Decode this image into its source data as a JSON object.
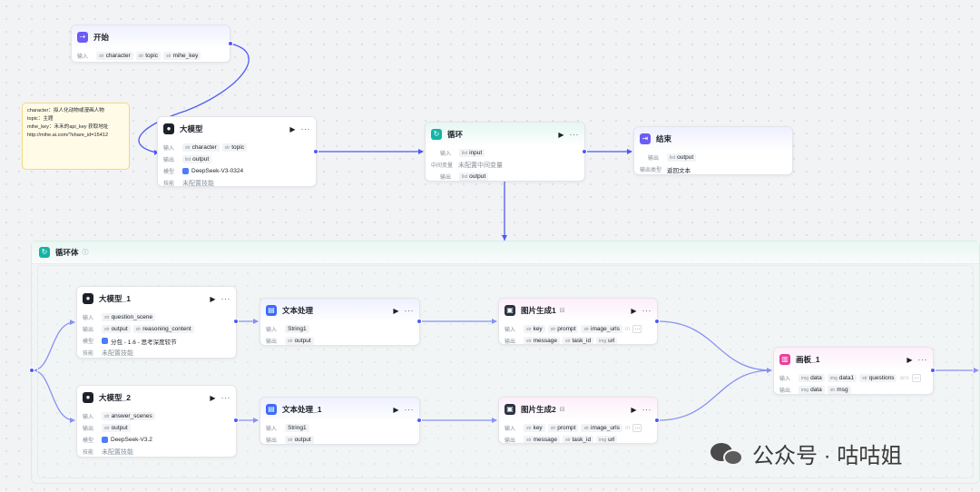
{
  "common": {
    "input_label": "输入",
    "output_label": "输出",
    "model_label": "模型",
    "skill_label": "技能",
    "skill_value": "未配置技能",
    "type_str": "str",
    "type_list": "list",
    "type_img": "img",
    "more": "···"
  },
  "note": {
    "lines": [
      "character：拟人化动物或漫画人物",
      "topic：主题",
      "mihe_key：禾禾的api_key 获取地址",
      "http://mihe.ai.com/?share_id=15412"
    ]
  },
  "start": {
    "title": "开始",
    "inputs": [
      "character",
      "topic",
      "mihe_key"
    ]
  },
  "llm_main": {
    "title": "大模型",
    "inputs": [
      "character",
      "topic"
    ],
    "outputs": [
      "output"
    ],
    "model": "DeepSeek-V3-0324"
  },
  "loop_node": {
    "title": "循环",
    "inputs": [
      "input"
    ],
    "mid_label": "中间变量",
    "mid_value": "未配置中间变量",
    "outputs": [
      "output"
    ]
  },
  "end": {
    "title": "结束",
    "outputs": [
      "output"
    ],
    "mode_label": "输出类型",
    "mode_value": "返回文本"
  },
  "loop_body": {
    "title": "循环体"
  },
  "llm1": {
    "title": "大模型_1",
    "inputs": [
      "question_scene"
    ],
    "outputs": [
      "output",
      "reasoning_content"
    ],
    "model": "分包 - 1.6 - 思考深度较节"
  },
  "llm2": {
    "title": "大模型_2",
    "inputs": [
      "answer_scenes"
    ],
    "outputs": [
      "output"
    ],
    "model": "DeepSeek-V3.2"
  },
  "text1": {
    "title": "文本处理",
    "inputs": [
      "String1"
    ],
    "outputs": [
      "output"
    ]
  },
  "text2": {
    "title": "文本处理_1",
    "inputs": [
      "String1"
    ],
    "outputs": [
      "output"
    ]
  },
  "img1": {
    "title": "图片生成1",
    "inputs": [
      "key",
      "prompt",
      "image_urls"
    ],
    "inputs_fade": "m",
    "outputs": [
      "message",
      "task_id",
      "url"
    ]
  },
  "img2": {
    "title": "图片生成2",
    "inputs": [
      "key",
      "prompt",
      "image_urls"
    ],
    "inputs_fade": "m",
    "outputs": [
      "message",
      "task_id",
      "url"
    ]
  },
  "board": {
    "title": "画板_1",
    "inputs": [
      "data",
      "data1",
      "questions"
    ],
    "inputs_fade": "ans",
    "outputs": [
      "data",
      "msg"
    ]
  },
  "watermark": {
    "text": "公众号 · 咕咕姐"
  },
  "colors": {
    "edge": "#4e5bf2",
    "canvas": "#f2f3f5",
    "note_bg": "#fffbe6"
  }
}
